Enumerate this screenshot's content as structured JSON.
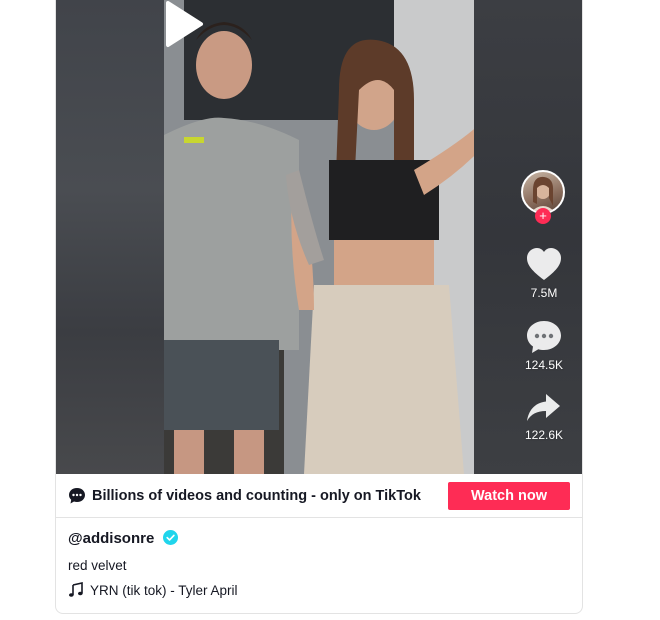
{
  "video": {
    "play_icon": "play-icon",
    "actions": {
      "likes": "7.5M",
      "comments": "124.5K",
      "shares": "122.6K"
    }
  },
  "banner": {
    "message": "Billions of videos and counting - only on TikTok",
    "cta": "Watch now"
  },
  "post": {
    "username": "@addisonre",
    "verified": true,
    "caption": "red velvet",
    "music": "YRN (tik tok) - Tyler April"
  },
  "colors": {
    "brand": "#fe2c55",
    "verified": "#20d5ec",
    "text": "#161823"
  }
}
